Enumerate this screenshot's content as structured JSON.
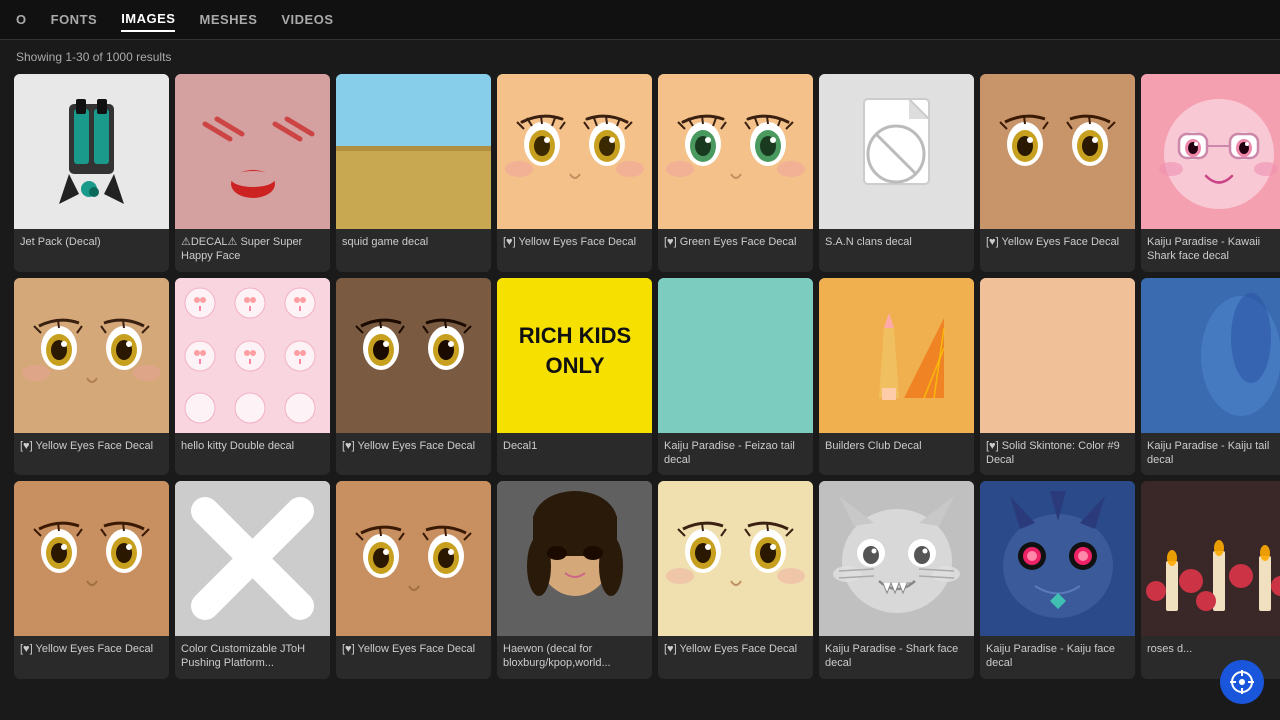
{
  "nav": {
    "items": [
      {
        "label": "O",
        "active": false
      },
      {
        "label": "FONTS",
        "active": false
      },
      {
        "label": "IMAGES",
        "active": true
      },
      {
        "label": "MESHES",
        "active": false
      },
      {
        "label": "VIDEOS",
        "active": false
      }
    ]
  },
  "results": {
    "showing": "Showing 1-30 of 1000 results"
  },
  "cards": [
    {
      "id": 1,
      "name": "Jet Pack (Decal)",
      "thumb_type": "jet"
    },
    {
      "id": 2,
      "name": "⚠DECAL⚠ Super Super Happy Face",
      "thumb_type": "decal-happy"
    },
    {
      "id": 3,
      "name": "squid game decal",
      "thumb_type": "squid"
    },
    {
      "id": 4,
      "name": "[♥] Yellow Eyes Face Decal",
      "thumb_type": "yellow-eyes"
    },
    {
      "id": 5,
      "name": "[♥] Green Eyes Face Decal",
      "thumb_type": "green-eyes"
    },
    {
      "id": 6,
      "name": "S.A.N clans decal",
      "thumb_type": "san-clans"
    },
    {
      "id": 7,
      "name": "[♥] Yellow Eyes Face Decal",
      "thumb_type": "yellow-eyes2"
    },
    {
      "id": 8,
      "name": "Kaiju Paradise - Kawaii Shark face decal",
      "thumb_type": "kaiju-pink"
    },
    {
      "id": 9,
      "name": "[♥] Yellow Eyes Face Decal",
      "thumb_type": "yellow-eyes3"
    },
    {
      "id": 10,
      "name": "hello kitty Double decal",
      "thumb_type": "hello-kitty"
    },
    {
      "id": 11,
      "name": "[♥] Yellow Eyes Face Decal",
      "thumb_type": "yellow-eyes4"
    },
    {
      "id": 12,
      "name": "Decal1",
      "thumb_type": "rich-kids"
    },
    {
      "id": 13,
      "name": "Kaiju Paradise - Feizao tail decal",
      "thumb_type": "kaiju-teal"
    },
    {
      "id": 14,
      "name": "Builders Club Decal",
      "thumb_type": "builders"
    },
    {
      "id": 15,
      "name": "[♥] Solid Skintone: Color #9 Decal",
      "thumb_type": "solid-skintone"
    },
    {
      "id": 16,
      "name": "Kaiju Paradise - Kaiju tail decal",
      "thumb_type": "kaiju-tail"
    },
    {
      "id": 17,
      "name": "[♥] Yellow Eyes Face Decal",
      "thumb_type": "yellow-eyes5"
    },
    {
      "id": 18,
      "name": "Color Customizable JToH Pushing Platform...",
      "thumb_type": "color-x"
    },
    {
      "id": 19,
      "name": "[♥] Yellow Eyes Face Decal",
      "thumb_type": "yellow-eyes6"
    },
    {
      "id": 20,
      "name": "Haewon (decal for bloxburg/kpop,world...",
      "thumb_type": "haewon"
    },
    {
      "id": 21,
      "name": "[♥] Yellow Eyes Face Decal",
      "thumb_type": "yellow-eyes7"
    },
    {
      "id": 22,
      "name": "Kaiju Paradise - Shark face decal",
      "thumb_type": "shark"
    },
    {
      "id": 23,
      "name": "Kaiju Paradise - Kaiju face decal",
      "thumb_type": "kaiju-blue"
    },
    {
      "id": 24,
      "name": "roses d...",
      "thumb_type": "roses"
    }
  ]
}
